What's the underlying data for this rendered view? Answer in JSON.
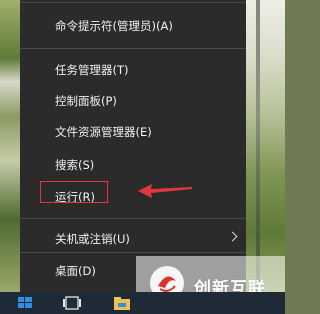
{
  "menu": {
    "items": [
      {
        "label": "命令提示符(管理员)(A)"
      },
      {
        "label": "任务管理器(T)"
      },
      {
        "label": "控制面板(P)"
      },
      {
        "label": "文件资源管理器(E)"
      },
      {
        "label": "搜索(S)"
      },
      {
        "label": "运行(R)"
      },
      {
        "label": "关机或注销(U)",
        "has_submenu": true
      },
      {
        "label": "桌面(D)"
      }
    ]
  },
  "annotation": {
    "highlight_color": "#e0383c",
    "arrow_color": "#e0383c"
  },
  "watermark": {
    "text": "创新互联"
  },
  "taskbar": {
    "items": [
      "start-button",
      "task-view-button",
      "file-explorer-button"
    ]
  }
}
